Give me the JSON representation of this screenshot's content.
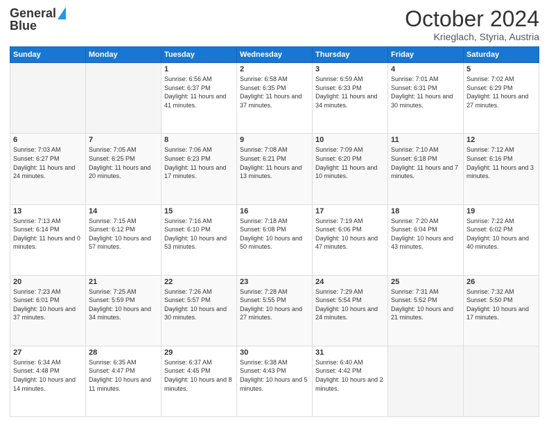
{
  "header": {
    "logo_line1": "General",
    "logo_line2": "Blue",
    "month": "October 2024",
    "location": "Krieglach, Styria, Austria"
  },
  "days_of_week": [
    "Sunday",
    "Monday",
    "Tuesday",
    "Wednesday",
    "Thursday",
    "Friday",
    "Saturday"
  ],
  "weeks": [
    [
      {
        "day": "",
        "content": ""
      },
      {
        "day": "",
        "content": ""
      },
      {
        "day": "1",
        "content": "Sunrise: 6:56 AM\nSunset: 6:37 PM\nDaylight: 11 hours and 41 minutes."
      },
      {
        "day": "2",
        "content": "Sunrise: 6:58 AM\nSunset: 6:35 PM\nDaylight: 11 hours and 37 minutes."
      },
      {
        "day": "3",
        "content": "Sunrise: 6:59 AM\nSunset: 6:33 PM\nDaylight: 11 hours and 34 minutes."
      },
      {
        "day": "4",
        "content": "Sunrise: 7:01 AM\nSunset: 6:31 PM\nDaylight: 11 hours and 30 minutes."
      },
      {
        "day": "5",
        "content": "Sunrise: 7:02 AM\nSunset: 6:29 PM\nDaylight: 11 hours and 27 minutes."
      }
    ],
    [
      {
        "day": "6",
        "content": "Sunrise: 7:03 AM\nSunset: 6:27 PM\nDaylight: 11 hours and 24 minutes."
      },
      {
        "day": "7",
        "content": "Sunrise: 7:05 AM\nSunset: 6:25 PM\nDaylight: 11 hours and 20 minutes."
      },
      {
        "day": "8",
        "content": "Sunrise: 7:06 AM\nSunset: 6:23 PM\nDaylight: 11 hours and 17 minutes."
      },
      {
        "day": "9",
        "content": "Sunrise: 7:08 AM\nSunset: 6:21 PM\nDaylight: 11 hours and 13 minutes."
      },
      {
        "day": "10",
        "content": "Sunrise: 7:09 AM\nSunset: 6:20 PM\nDaylight: 11 hours and 10 minutes."
      },
      {
        "day": "11",
        "content": "Sunrise: 7:10 AM\nSunset: 6:18 PM\nDaylight: 11 hours and 7 minutes."
      },
      {
        "day": "12",
        "content": "Sunrise: 7:12 AM\nSunset: 6:16 PM\nDaylight: 11 hours and 3 minutes."
      }
    ],
    [
      {
        "day": "13",
        "content": "Sunrise: 7:13 AM\nSunset: 6:14 PM\nDaylight: 11 hours and 0 minutes."
      },
      {
        "day": "14",
        "content": "Sunrise: 7:15 AM\nSunset: 6:12 PM\nDaylight: 10 hours and 57 minutes."
      },
      {
        "day": "15",
        "content": "Sunrise: 7:16 AM\nSunset: 6:10 PM\nDaylight: 10 hours and 53 minutes."
      },
      {
        "day": "16",
        "content": "Sunrise: 7:18 AM\nSunset: 6:08 PM\nDaylight: 10 hours and 50 minutes."
      },
      {
        "day": "17",
        "content": "Sunrise: 7:19 AM\nSunset: 6:06 PM\nDaylight: 10 hours and 47 minutes."
      },
      {
        "day": "18",
        "content": "Sunrise: 7:20 AM\nSunset: 6:04 PM\nDaylight: 10 hours and 43 minutes."
      },
      {
        "day": "19",
        "content": "Sunrise: 7:22 AM\nSunset: 6:02 PM\nDaylight: 10 hours and 40 minutes."
      }
    ],
    [
      {
        "day": "20",
        "content": "Sunrise: 7:23 AM\nSunset: 6:01 PM\nDaylight: 10 hours and 37 minutes."
      },
      {
        "day": "21",
        "content": "Sunrise: 7:25 AM\nSunset: 5:59 PM\nDaylight: 10 hours and 34 minutes."
      },
      {
        "day": "22",
        "content": "Sunrise: 7:26 AM\nSunset: 5:57 PM\nDaylight: 10 hours and 30 minutes."
      },
      {
        "day": "23",
        "content": "Sunrise: 7:28 AM\nSunset: 5:55 PM\nDaylight: 10 hours and 27 minutes."
      },
      {
        "day": "24",
        "content": "Sunrise: 7:29 AM\nSunset: 5:54 PM\nDaylight: 10 hours and 24 minutes."
      },
      {
        "day": "25",
        "content": "Sunrise: 7:31 AM\nSunset: 5:52 PM\nDaylight: 10 hours and 21 minutes."
      },
      {
        "day": "26",
        "content": "Sunrise: 7:32 AM\nSunset: 5:50 PM\nDaylight: 10 hours and 17 minutes."
      }
    ],
    [
      {
        "day": "27",
        "content": "Sunrise: 6:34 AM\nSunset: 4:48 PM\nDaylight: 10 hours and 14 minutes."
      },
      {
        "day": "28",
        "content": "Sunrise: 6:35 AM\nSunset: 4:47 PM\nDaylight: 10 hours and 11 minutes."
      },
      {
        "day": "29",
        "content": "Sunrise: 6:37 AM\nSunset: 4:45 PM\nDaylight: 10 hours and 8 minutes."
      },
      {
        "day": "30",
        "content": "Sunrise: 6:38 AM\nSunset: 4:43 PM\nDaylight: 10 hours and 5 minutes."
      },
      {
        "day": "31",
        "content": "Sunrise: 6:40 AM\nSunset: 4:42 PM\nDaylight: 10 hours and 2 minutes."
      },
      {
        "day": "",
        "content": ""
      },
      {
        "day": "",
        "content": ""
      }
    ]
  ]
}
